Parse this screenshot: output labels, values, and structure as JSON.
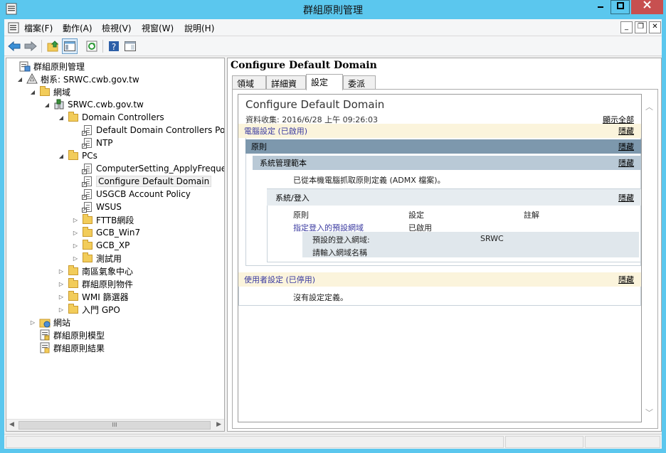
{
  "window": {
    "title": "群組原則管理"
  },
  "menu": [
    "檔案(F)",
    "動作(A)",
    "檢視(V)",
    "視窗(W)",
    "說明(H)"
  ],
  "tree": [
    {
      "label": "群組原則管理",
      "indent": 0,
      "tw": "",
      "icon": "gpm"
    },
    {
      "label": "樹系: SRWC.cwb.gov.tw",
      "indent": 1,
      "tw": "◢",
      "icon": "forest"
    },
    {
      "label": "網域",
      "indent": 2,
      "tw": "◢",
      "icon": "folder"
    },
    {
      "label": "SRWC.cwb.gov.tw",
      "indent": 3,
      "tw": "◢",
      "icon": "domain"
    },
    {
      "label": "Domain Controllers",
      "indent": 4,
      "tw": "◢",
      "icon": "folder"
    },
    {
      "label": "Default Domain Controllers Policy",
      "indent": 5,
      "tw": "",
      "icon": "gpo"
    },
    {
      "label": "NTP",
      "indent": 5,
      "tw": "",
      "icon": "gpo"
    },
    {
      "label": "PCs",
      "indent": 4,
      "tw": "◢",
      "icon": "folder"
    },
    {
      "label": "ComputerSetting_ApplyFrequency",
      "indent": 5,
      "tw": "",
      "icon": "gpo"
    },
    {
      "label": "Configure Default Domain",
      "indent": 5,
      "tw": "",
      "icon": "gpo",
      "selected": true
    },
    {
      "label": "USGCB Account Policy",
      "indent": 5,
      "tw": "",
      "icon": "gpo"
    },
    {
      "label": "WSUS",
      "indent": 5,
      "tw": "",
      "icon": "gpo"
    },
    {
      "label": "FTTB網段",
      "indent": 5,
      "tw": "▷",
      "icon": "folder"
    },
    {
      "label": "GCB_Win7",
      "indent": 5,
      "tw": "▷",
      "icon": "folder"
    },
    {
      "label": "GCB_XP",
      "indent": 5,
      "tw": "▷",
      "icon": "folder"
    },
    {
      "label": "測試用",
      "indent": 5,
      "tw": "▷",
      "icon": "folder"
    },
    {
      "label": "南區氣象中心",
      "indent": 4,
      "tw": "▷",
      "icon": "folder"
    },
    {
      "label": "群組原則物件",
      "indent": 4,
      "tw": "▷",
      "icon": "folder"
    },
    {
      "label": "WMI 篩選器",
      "indent": 4,
      "tw": "▷",
      "icon": "folder"
    },
    {
      "label": "入門 GPO",
      "indent": 4,
      "tw": "▷",
      "icon": "folder"
    },
    {
      "label": "網站",
      "indent": 2,
      "tw": "▷",
      "icon": "sites"
    },
    {
      "label": "群組原則模型",
      "indent": 2,
      "tw": "",
      "icon": "model"
    },
    {
      "label": "群組原則結果",
      "indent": 2,
      "tw": "",
      "icon": "results"
    }
  ],
  "right": {
    "title": "Configure Default Domain",
    "tabs": [
      "領域",
      "詳細資料",
      "設定",
      "委派"
    ],
    "active_tab": 2,
    "report": {
      "title": "Configure Default Domain",
      "collected": "資料收集: 2016/6/28 上午 09:26:03",
      "show_all": "顯示全部",
      "hide": "隱藏",
      "computer_section": "電腦設定 (已啟用)",
      "policies": "原則",
      "admin_templates": "系統管理範本",
      "admx_note": "已從本機電腦抓取原則定義 (ADMX 檔案)。",
      "system_logon": "系統/登入",
      "col_policy": "原則",
      "col_setting": "設定",
      "col_comment": "註解",
      "policy_name": "指定登入的預設網域",
      "policy_state": "已啟用",
      "sub_label1": "預設的登入網域:",
      "sub_value1": "SRWC",
      "sub_label2": "請輸入網域名稱",
      "user_section": "使用者設定 (已停用)",
      "no_settings": "沒有設定定義。"
    }
  }
}
